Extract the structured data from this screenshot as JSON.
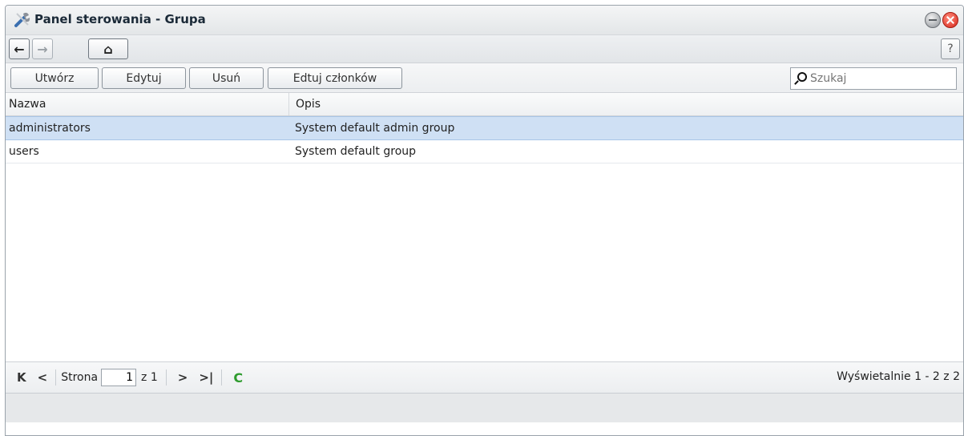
{
  "window": {
    "title": "Panel sterowania - Grupa"
  },
  "nav": {
    "back_glyph": "←",
    "forward_glyph": "→",
    "home_glyph": "⌂",
    "help_label": "?"
  },
  "toolbar": {
    "create_label": "Utwórz",
    "edit_label": "Edytuj",
    "delete_label": "Usuń",
    "members_label": "Edtuj członków",
    "search_placeholder": "Szukaj"
  },
  "table": {
    "columns": [
      "Nazwa",
      "Opis"
    ],
    "rows": [
      {
        "name": "administrators",
        "desc": "System default admin group",
        "selected": true
      },
      {
        "name": "users",
        "desc": "System default group",
        "selected": false
      }
    ]
  },
  "pager": {
    "first_glyph": "K",
    "prev_glyph": "<",
    "page_label": "Strona",
    "page_value": "1",
    "of_label": "z 1",
    "next_glyph": ">",
    "last_glyph": ">|",
    "refresh_glyph": "C",
    "info": "Wyświetalnie 1 - 2 z 2"
  },
  "colors": {
    "selected_row": "#cfe0f4",
    "refresh": "#2e9b2e",
    "close": "#d6281c"
  },
  "icons": [
    "tools-icon",
    "minimize-icon",
    "close-icon",
    "back-icon",
    "forward-icon",
    "home-icon",
    "help-icon",
    "search-icon",
    "first-page-icon",
    "prev-page-icon",
    "next-page-icon",
    "last-page-icon",
    "refresh-icon"
  ]
}
